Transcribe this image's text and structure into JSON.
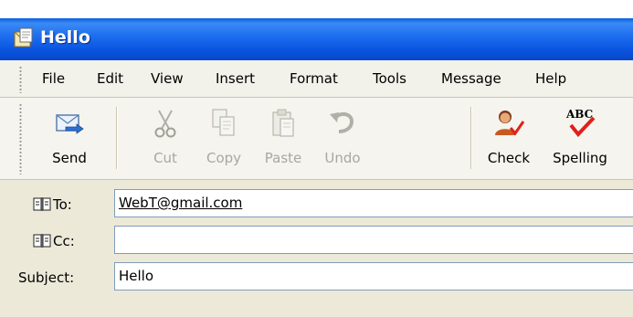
{
  "window": {
    "title": "Hello"
  },
  "menu": {
    "items": [
      {
        "label": "File"
      },
      {
        "label": "Edit"
      },
      {
        "label": "View"
      },
      {
        "label": "Insert"
      },
      {
        "label": "Format"
      },
      {
        "label": "Tools"
      },
      {
        "label": "Message"
      },
      {
        "label": "Help"
      }
    ]
  },
  "toolbar": {
    "buttons": [
      {
        "label": "Send",
        "icon": "send-icon",
        "enabled": true
      },
      {
        "label": "Cut",
        "icon": "scissors-icon",
        "enabled": false
      },
      {
        "label": "Copy",
        "icon": "copy-icon",
        "enabled": false
      },
      {
        "label": "Paste",
        "icon": "paste-icon",
        "enabled": false
      },
      {
        "label": "Undo",
        "icon": "undo-icon",
        "enabled": false
      },
      {
        "label": "Check",
        "icon": "check-names-icon",
        "enabled": true
      },
      {
        "label": "Spelling",
        "icon": "spelling-icon",
        "enabled": true
      }
    ]
  },
  "headers": {
    "to_label": "To:",
    "to_value": "WebT@gmail.com",
    "cc_label": "Cc:",
    "cc_value": "",
    "subject_label": "Subject:",
    "subject_value": "Hello"
  },
  "colors": {
    "titlebar": "#0a55e0",
    "window_bg": "#ece9d8",
    "field_border": "#7f9db9",
    "disabled_text": "#a8a8a0"
  }
}
